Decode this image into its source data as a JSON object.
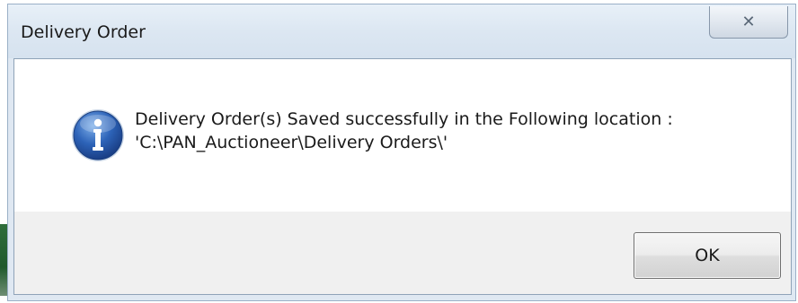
{
  "dialog": {
    "title": "Delivery Order",
    "close_glyph": "✕",
    "icon": "info-icon",
    "message_line1": "Delivery Order(s) Saved successfully in the Following location :",
    "message_line2": "'C:\\PAN_Auctioneer\\Delivery Orders\\'",
    "ok_label": "OK"
  },
  "colors": {
    "title_bar": "#dce7f2",
    "content_bg": "#f0f0f0",
    "message_bg": "#ffffff",
    "info_icon_blue": "#2d63b8"
  }
}
